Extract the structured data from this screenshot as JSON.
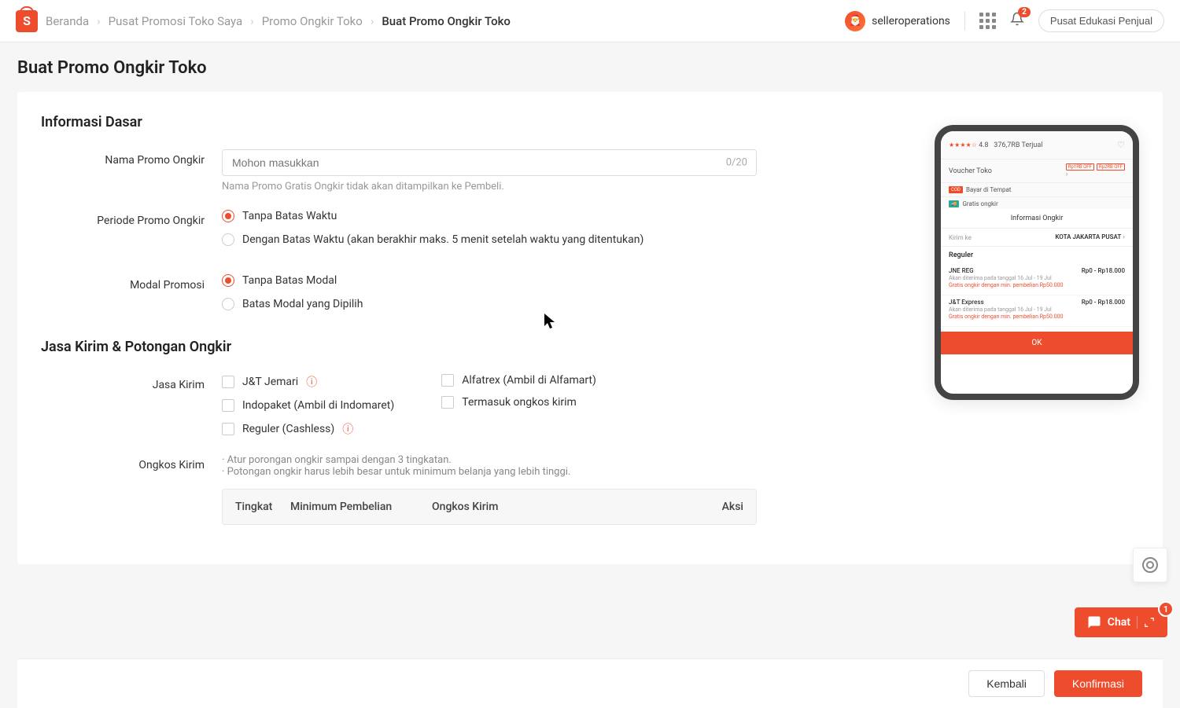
{
  "header": {
    "logo_letter": "S",
    "breadcrumbs": [
      "Beranda",
      "Pusat Promosi Toko Saya",
      "Promo Ongkir Toko",
      "Buat Promo Ongkir Toko"
    ],
    "username": "selleroperations",
    "notification_count": "2",
    "edu_button": "Pusat Edukasi Penjual"
  },
  "page_title": "Buat Promo Ongkir Toko",
  "section_basic": {
    "title": "Informasi Dasar",
    "name_label": "Nama Promo Ongkir",
    "name_placeholder": "Mohon masukkan",
    "name_counter": "0/20",
    "name_help": "Nama Promo Gratis Ongkir tidak akan ditampilkan ke Pembeli.",
    "period_label": "Periode Promo Ongkir",
    "period_opt1": "Tanpa Batas Waktu",
    "period_opt2": "Dengan Batas Waktu (akan berakhir maks. 5 menit setelah waktu yang ditentukan)",
    "modal_label": "Modal Promosi",
    "modal_opt1": "Tanpa Batas Modal",
    "modal_opt2": "Batas Modal yang Dipilih"
  },
  "section_ship": {
    "title": "Jasa Kirim & Potongan Ongkir",
    "jasa_label": "Jasa Kirim",
    "services_left": [
      "J&T Jemari",
      "Indopaket (Ambil di Indomaret)",
      "Reguler (Cashless)"
    ],
    "services_right": [
      "Alfatrex (Ambil di Alfamart)",
      "Termasuk ongkos kirim"
    ],
    "ongkos_label": "Ongkos Kirim",
    "ongkos_help1": "Atur porongan ongkir sampai dengan 3 tingkatan.",
    "ongkos_help2": "Potongan ongkir harus lebih besar untuk minimum belanja yang lebih tinggi.",
    "th_tingkat": "Tingkat",
    "th_min": "Minimum Pembelian",
    "th_ongkos": "Ongkos Kirim",
    "th_aksi": "Aksi"
  },
  "preview": {
    "rating": "4.8",
    "sold": "376,7RB Terjual",
    "voucher": "Voucher Toko",
    "tag1": "Rp1RB OFF",
    "tag2": "Rp2RB OFF",
    "cod": "Bayar di Tempat",
    "gratis": "Gratis ongkir",
    "modal_title": "Informasi Ongkir",
    "kirim_ke": "Kirim ke",
    "city": "KOTA JAKARTA PUSAT",
    "reguler": "Reguler",
    "ship1_name": "JNE REG",
    "ship1_price": "Rp0 - Rp18.000",
    "ship1_sub": "Akan diterima pada tanggal 16 Jul - 19 Jul",
    "ship1_promo": "Gratis ongkir dengan min. pembelian Rp50.000",
    "ship2_name": "J&T Express",
    "ship2_price": "Rp0 - Rp18.000",
    "ship2_sub": "Akan diterima pada tanggal 16 Jul - 19 Jul",
    "ship2_promo": "Gratis ongkir dengan min. pembelian Rp50.000",
    "ok": "OK"
  },
  "footer": {
    "back": "Kembali",
    "confirm": "Konfirmasi"
  },
  "chat": {
    "label": "Chat",
    "count": "1"
  }
}
